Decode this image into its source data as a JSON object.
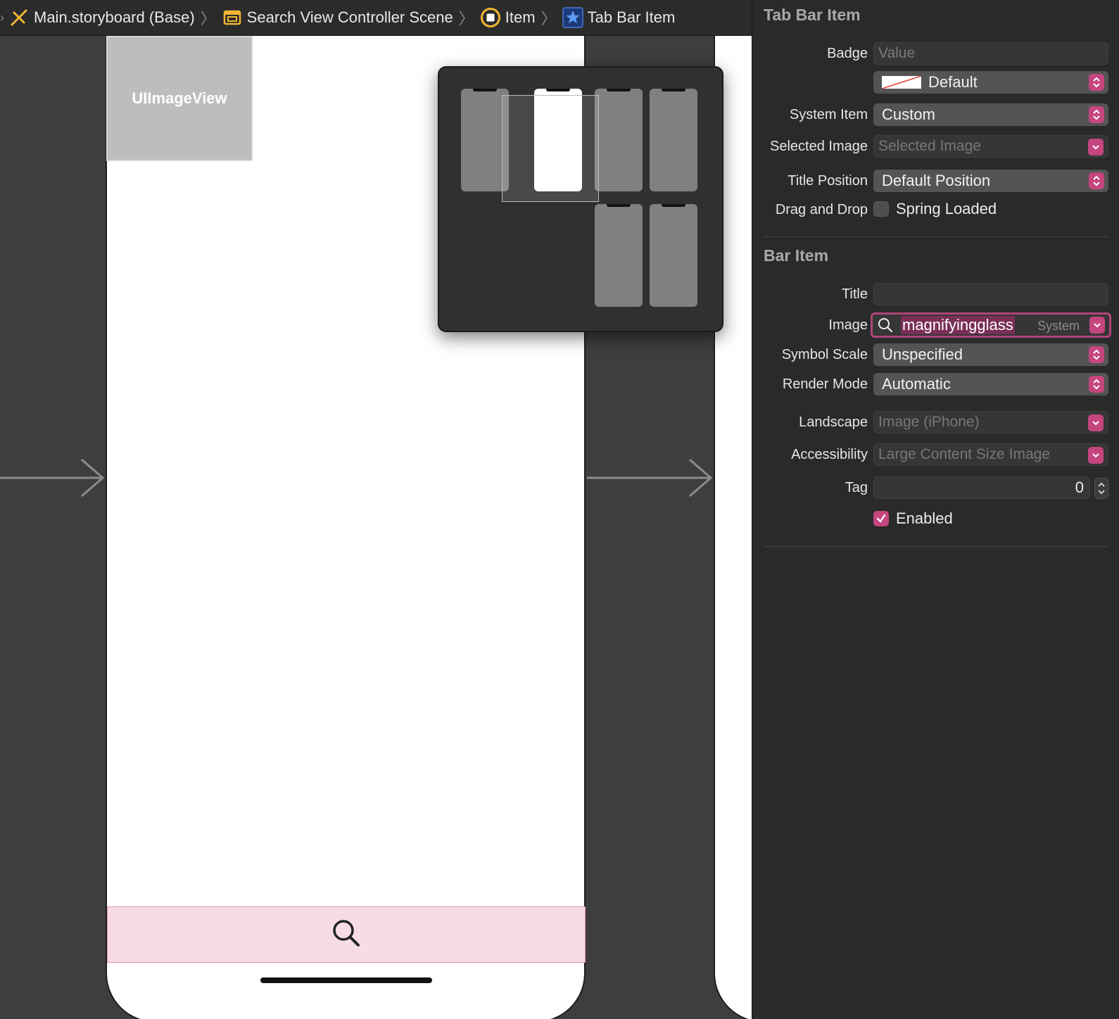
{
  "breadcrumb": {
    "items": [
      {
        "label": "Main.storyboard (Base)",
        "icon": "storyboard-icon"
      },
      {
        "label": "Search View Controller Scene",
        "icon": "scene-icon"
      },
      {
        "label": "Item",
        "icon": "view-controller-icon"
      },
      {
        "label": "Tab Bar Item",
        "icon": "star-icon"
      }
    ]
  },
  "canvas": {
    "image_view_label": "UIImageView",
    "tab_bar_icon": "magnifyingglass-icon"
  },
  "inspector": {
    "tab_bar_item": {
      "title": "Tab Bar Item",
      "badge_label": "Badge",
      "badge_placeholder": "Value",
      "badge_color_value": "Default",
      "system_item_label": "System Item",
      "system_item_value": "Custom",
      "selected_image_label": "Selected Image",
      "selected_image_placeholder": "Selected Image",
      "title_position_label": "Title Position",
      "title_position_value": "Default Position",
      "drag_drop_label": "Drag and Drop",
      "spring_loaded_label": "Spring Loaded",
      "spring_loaded_checked": false
    },
    "bar_item": {
      "title": "Bar Item",
      "title_label": "Title",
      "title_value": "",
      "image_label": "Image",
      "image_value": "magnifyingglass",
      "image_source": "System",
      "symbol_scale_label": "Symbol Scale",
      "symbol_scale_value": "Unspecified",
      "render_mode_label": "Render Mode",
      "render_mode_value": "Automatic",
      "landscape_label": "Landscape",
      "landscape_placeholder": "Image (iPhone)",
      "accessibility_label": "Accessibility",
      "accessibility_placeholder": "Large Content Size Image",
      "tag_label": "Tag",
      "tag_value": "0",
      "enabled_label": "Enabled",
      "enabled_checked": true
    }
  },
  "colors": {
    "accent": "#c5457f",
    "tab_bar_fill": "#f7dbe7",
    "canvas_bg": "#3e3e3e",
    "inspector_bg": "#2a2a2a"
  }
}
